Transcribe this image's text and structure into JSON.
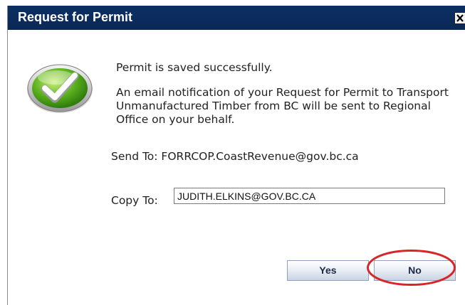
{
  "dialog": {
    "title": "Request for Permit",
    "close_glyph": "✕"
  },
  "message": {
    "line1": "Permit is saved successfully.",
    "line2": "An email notification of your Request for Permit to Transport Unmanufactured Timber from BC will be sent to Regional Office on your behalf."
  },
  "send_to": {
    "text": "Send To: FORRCOP.CoastRevenue@gov.bc.ca"
  },
  "copy_to": {
    "label": "Copy To:",
    "value": "JUDITH.ELKINS@GOV.BC.CA"
  },
  "buttons": {
    "yes": "Yes",
    "no": "No"
  },
  "icons": {
    "success": "checkmark-success-icon",
    "close": "close-icon"
  },
  "colors": {
    "titlebar": "#0a2857",
    "highlight": "#d6262a"
  }
}
